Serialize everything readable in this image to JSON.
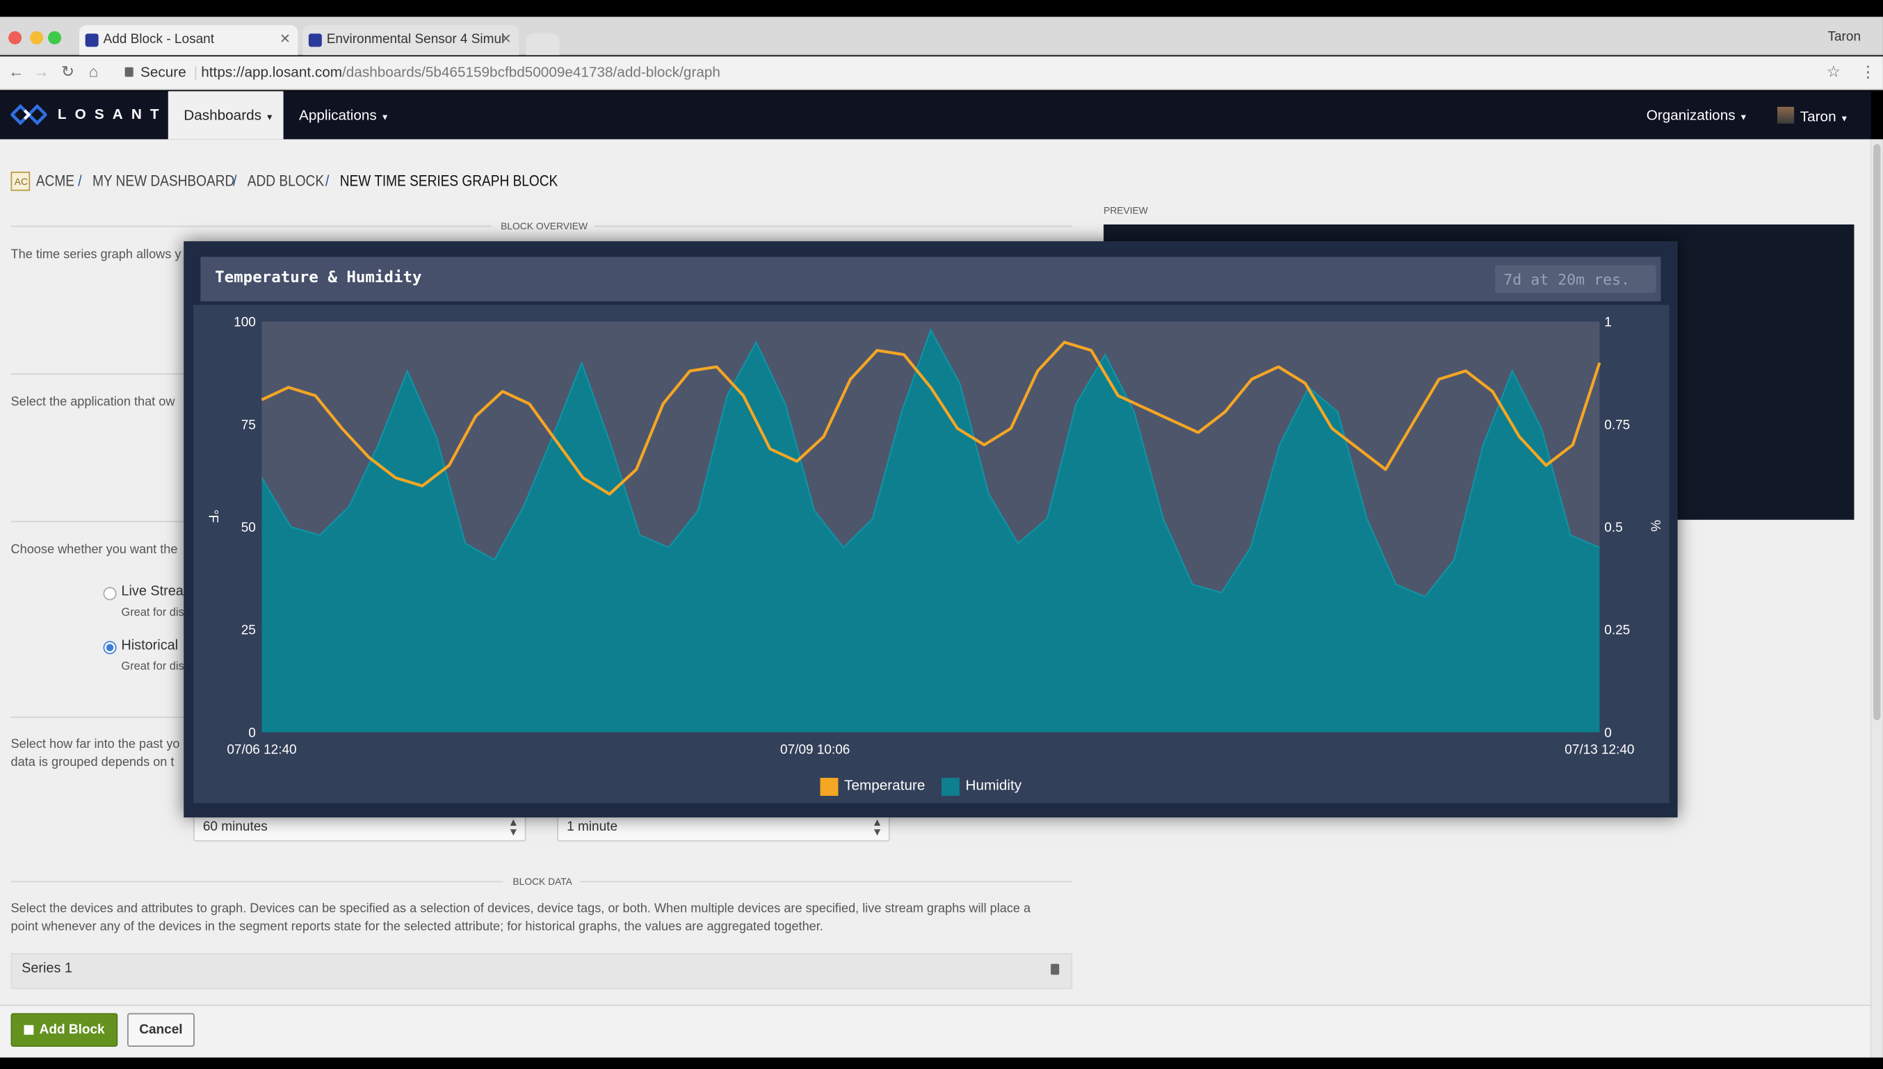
{
  "browser": {
    "tabs": [
      {
        "label": "Add Block - Losant"
      },
      {
        "label": "Environmental Sensor 4 Simul"
      }
    ],
    "user": "Taron",
    "secure_label": "Secure",
    "url_host": "https://app.losant.com",
    "url_path": "/dashboards/5b465159bcfbd50009e41738/add-block/graph"
  },
  "appnav": {
    "logo": "LOSANT",
    "dashboards": "Dashboards",
    "applications": "Applications",
    "organizations": "Organizations",
    "user": "Taron"
  },
  "breadcrumb": {
    "org_badge": "AC",
    "items": [
      "ACME",
      "MY NEW DASHBOARD",
      "ADD BLOCK",
      "NEW TIME SERIES GRAPH BLOCK"
    ],
    "sep": "/"
  },
  "form": {
    "overview_label": "BLOCK OVERVIEW",
    "preview_label": "PREVIEW",
    "intro": "The time series graph allows y",
    "app_text": "Select the application that ow",
    "mode_text": "Choose whether you want the",
    "live_label": "Live Strea",
    "live_sub": "Great for dis",
    "historical_label": "Historical",
    "historical_sub": "Great for dis",
    "selected_mode": "Historical",
    "range_text_1": "Select how far into the past yo",
    "range_text_2": "data is grouped depends on t",
    "range_value": "60 minutes",
    "resolution_value": "1 minute",
    "data_label": "BLOCK DATA",
    "data_text_1": "Select the devices and attributes to graph. Devices can be specified as a selection of devices, device tags, or both. When multiple devices are specified, live stream graphs will place a",
    "data_text_2": "point whenever any of the devices in the segment reports state for the selected attribute; for historical graphs, the values are aggregated together.",
    "series_label": "Series 1",
    "add_block": "Add Block",
    "cancel": "Cancel"
  },
  "modal": {
    "title": "Temperature & Humidity",
    "badge": "7d at 20m res."
  },
  "colors": {
    "temperature": "#f5a623",
    "humidity": "#0d7f8f",
    "nav_bg": "#0e1221",
    "add_button": "#64921e"
  },
  "chart_data": {
    "type": "area",
    "x": [
      "07/06 12:40",
      "07/13 12:40"
    ],
    "x_ticks": [
      "07/06 12:40",
      "07/09 10:06",
      "07/13 12:40"
    ],
    "y_left": {
      "unit": "°F",
      "lim": [
        0,
        100
      ],
      "ticks": [
        "0",
        "25",
        "50",
        "75",
        "100"
      ]
    },
    "y_right": {
      "unit": "%",
      "lim": [
        0,
        1
      ],
      "ticks": [
        "0",
        "0.25",
        "0.5",
        "0.75",
        "1"
      ]
    },
    "legend": "bottom-center",
    "series": [
      {
        "name": "Temperature",
        "type": "line",
        "axis": "left",
        "values": [
          81,
          84,
          82,
          74,
          67,
          62,
          60,
          65,
          77,
          83,
          80,
          71,
          62,
          58,
          64,
          80,
          88,
          89,
          82,
          69,
          66,
          72,
          86,
          93,
          92,
          84,
          74,
          70,
          74,
          88,
          95,
          93,
          82,
          79,
          76,
          73,
          78,
          86,
          89,
          85,
          74,
          69,
          64,
          75,
          86,
          88,
          83,
          72,
          65,
          70,
          90
        ]
      },
      {
        "name": "Humidity",
        "type": "area",
        "axis": "right",
        "values": [
          0.62,
          0.5,
          0.48,
          0.55,
          0.7,
          0.88,
          0.72,
          0.46,
          0.42,
          0.55,
          0.72,
          0.9,
          0.7,
          0.48,
          0.45,
          0.54,
          0.82,
          0.95,
          0.8,
          0.54,
          0.45,
          0.52,
          0.78,
          0.98,
          0.85,
          0.58,
          0.46,
          0.52,
          0.8,
          0.92,
          0.78,
          0.52,
          0.36,
          0.34,
          0.45,
          0.7,
          0.84,
          0.78,
          0.52,
          0.36,
          0.33,
          0.42,
          0.7,
          0.88,
          0.74,
          0.48,
          0.45
        ]
      }
    ]
  }
}
